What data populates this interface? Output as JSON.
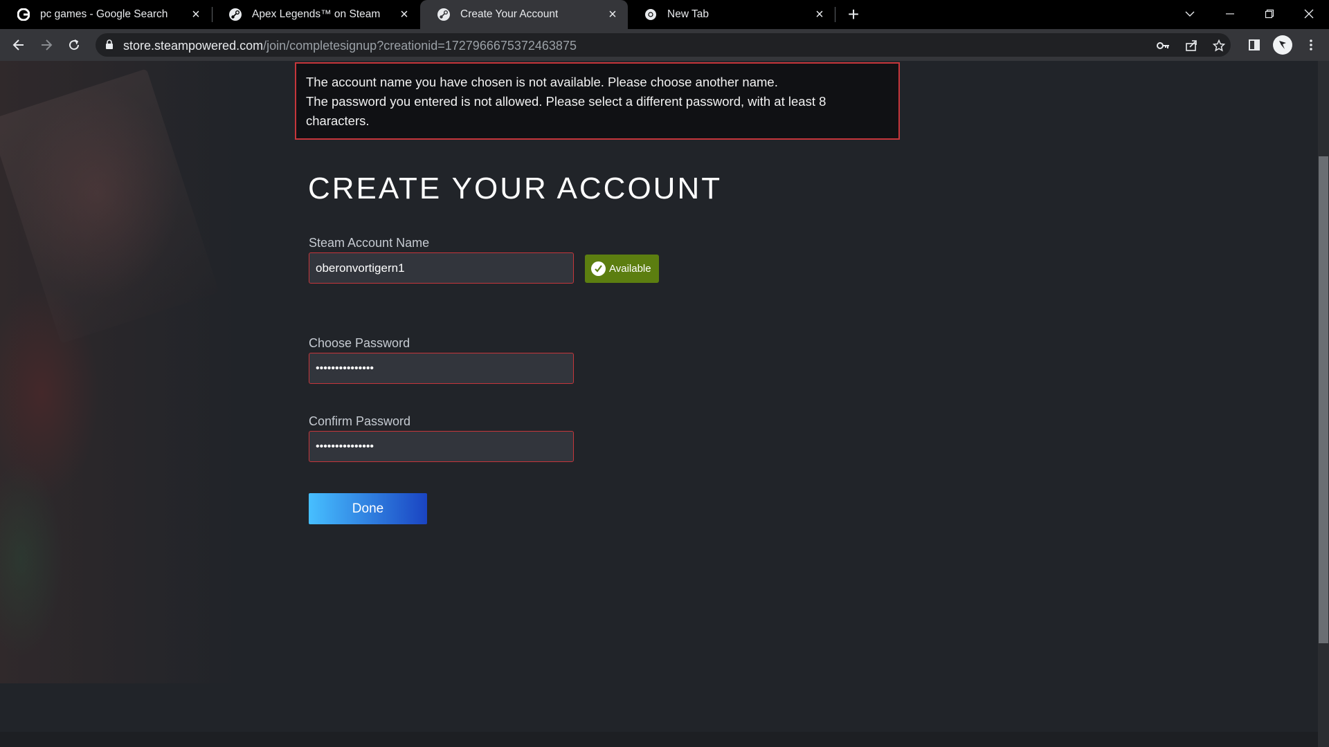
{
  "browser": {
    "tabs": [
      {
        "title": "pc games - Google Search",
        "icon": "google-icon",
        "active": false
      },
      {
        "title": "Apex Legends™ on Steam",
        "icon": "steam-icon",
        "active": false
      },
      {
        "title": "Create Your Account",
        "icon": "steam-icon",
        "active": true
      },
      {
        "title": "New Tab",
        "icon": "chrome-icon",
        "active": false
      }
    ],
    "url_host": "store.steampowered.com",
    "url_path": "/join/completesignup?creationid=1727966675372463875"
  },
  "errors": {
    "line1": "The account name you have chosen is not available. Please choose another name.",
    "line2": "The password you entered is not allowed. Please select a different password, with at least 8 characters."
  },
  "form": {
    "heading": "CREATE YOUR ACCOUNT",
    "account_name_label": "Steam Account Name",
    "account_name_value": "oberonvortigern1",
    "availability_badge": "Available",
    "password_label": "Choose Password",
    "password_value": "•••••••••••••••",
    "confirm_label": "Confirm Password",
    "confirm_value": "•••••••••••••••",
    "done_label": "Done"
  },
  "colors": {
    "error_border": "#c6363b",
    "available_green": "#5c7e10",
    "button_gradient_start": "#47bfff",
    "button_gradient_end": "#1a44c2"
  }
}
